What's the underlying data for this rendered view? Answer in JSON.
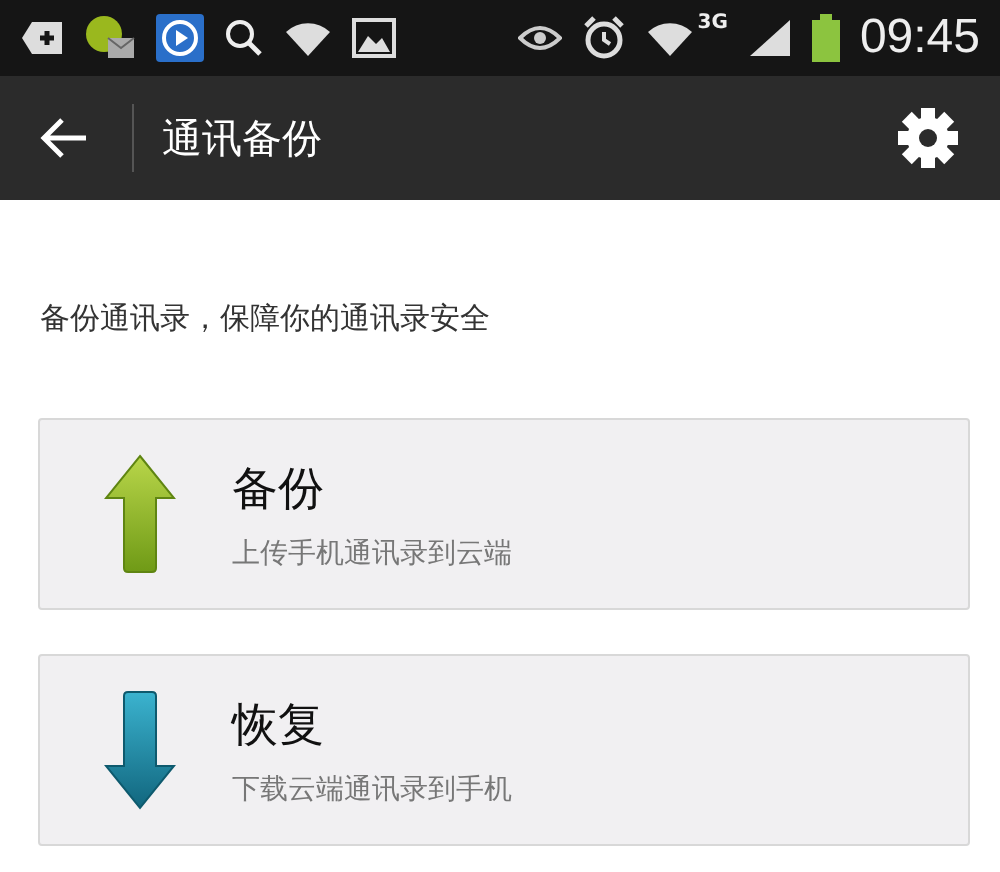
{
  "status_bar": {
    "network": "3G",
    "time": "09:45"
  },
  "toolbar": {
    "title": "通讯备份"
  },
  "description": "备份通讯录，保障你的通讯录安全",
  "actions": [
    {
      "kind": "upload",
      "title": "备份",
      "subtitle": "上传手机通讯录到云端"
    },
    {
      "kind": "download",
      "title": "恢复",
      "subtitle": "下载云端通讯录到手机"
    }
  ]
}
